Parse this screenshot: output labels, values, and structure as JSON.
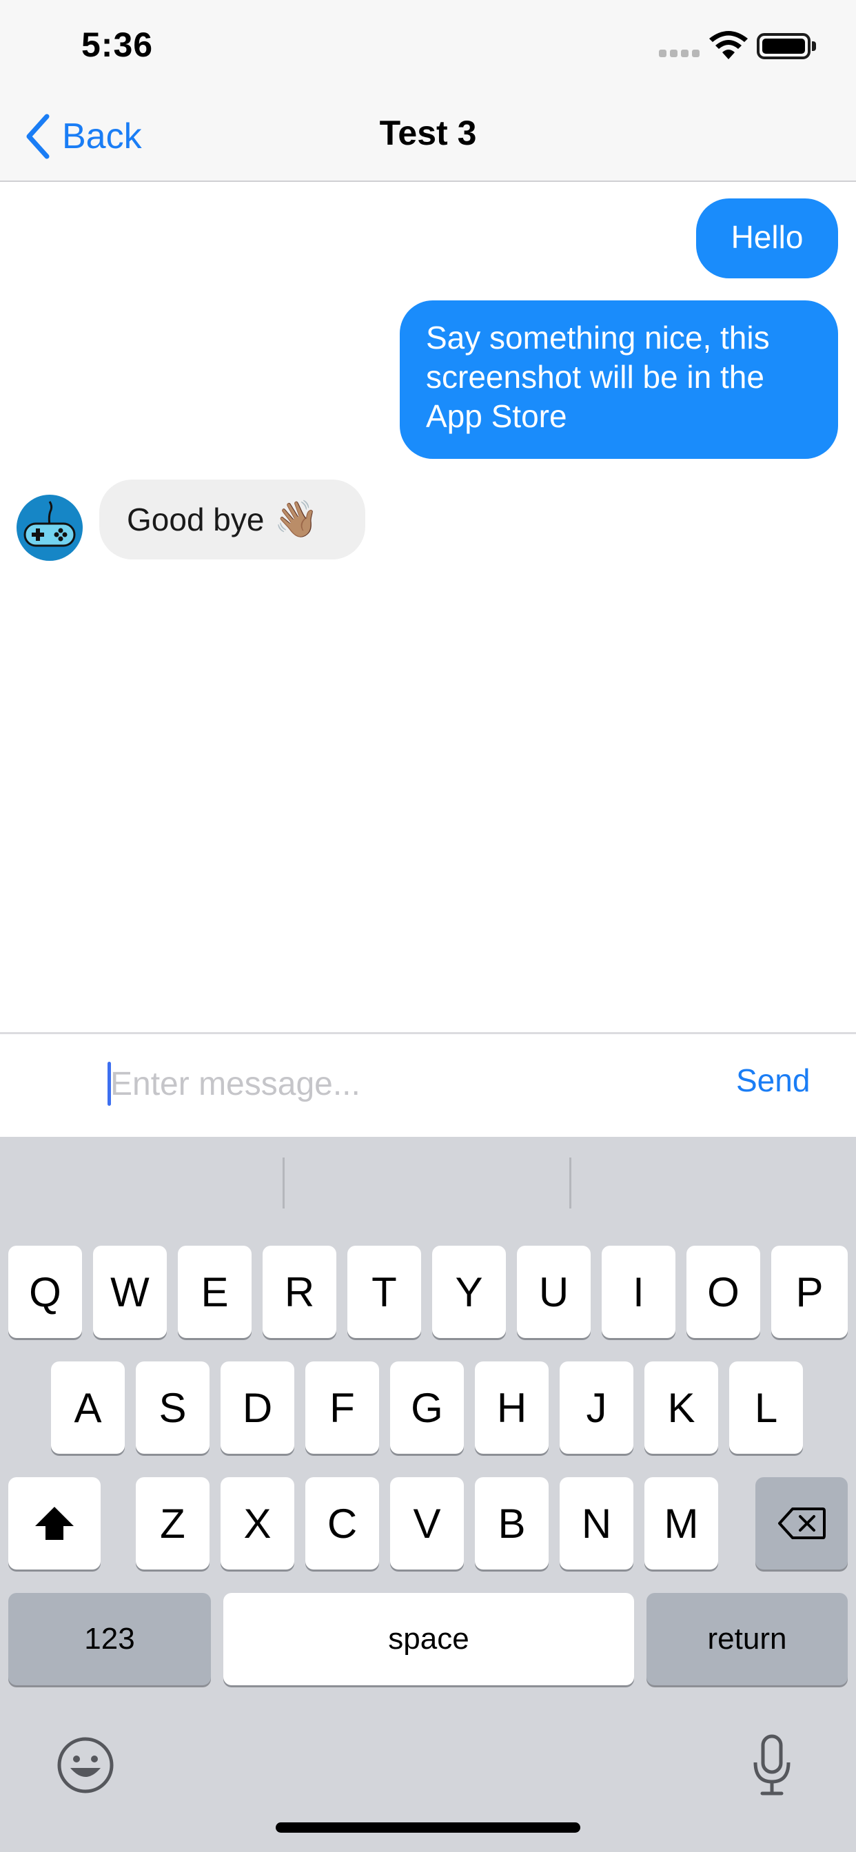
{
  "status_bar": {
    "time": "5:36"
  },
  "nav": {
    "back_label": "Back",
    "title": "Test 3"
  },
  "messages": [
    {
      "direction": "outgoing",
      "text": "Hello"
    },
    {
      "direction": "outgoing",
      "text": "Say something nice, this screenshot will be in the App Store"
    },
    {
      "direction": "incoming",
      "text": "Good bye",
      "emoji": "👋🏽",
      "avatar_icon": "gamepad-icon"
    }
  ],
  "composer": {
    "placeholder": "Enter message...",
    "value": "",
    "send_label": "Send"
  },
  "keyboard": {
    "row1": [
      "Q",
      "W",
      "E",
      "R",
      "T",
      "Y",
      "U",
      "I",
      "O",
      "P"
    ],
    "row2": [
      "A",
      "S",
      "D",
      "F",
      "G",
      "H",
      "J",
      "K",
      "L"
    ],
    "row3": [
      "Z",
      "X",
      "C",
      "V",
      "B",
      "N",
      "M"
    ],
    "numbers_label": "123",
    "space_label": "space",
    "return_label": "return",
    "icons": [
      "shift-icon",
      "backspace-icon",
      "emoji-icon",
      "microphone-icon"
    ]
  },
  "colors": {
    "accent": "#1a7df5",
    "outgoing_bubble": "#1a8cfb",
    "incoming_bubble": "#efefef",
    "keyboard_bg": "#d3d5da"
  }
}
